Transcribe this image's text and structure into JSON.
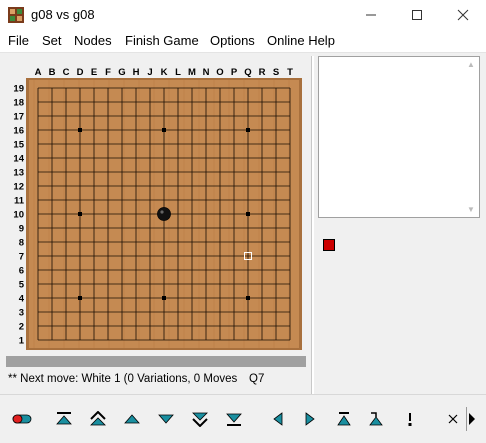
{
  "window": {
    "title": "g08 vs g08",
    "controls": [
      "minimize",
      "maximize",
      "close"
    ]
  },
  "menu": [
    "File",
    "Set",
    "Nodes",
    "Finish Game",
    "Options",
    "Online Help"
  ],
  "board": {
    "size": 19,
    "columns": [
      "A",
      "B",
      "C",
      "D",
      "E",
      "F",
      "G",
      "H",
      "J",
      "K",
      "L",
      "M",
      "N",
      "O",
      "P",
      "Q",
      "R",
      "S",
      "T"
    ],
    "rows": [
      "19",
      "18",
      "17",
      "16",
      "15",
      "14",
      "13",
      "12",
      "11",
      "10",
      "9",
      "8",
      "7",
      "6",
      "5",
      "4",
      "3",
      "2",
      "1"
    ],
    "colors": {
      "wood": "#c58a52",
      "frame": "#a8703d",
      "line": "#1a0e05",
      "black_stone": "#111111"
    },
    "star_points": [
      "D16",
      "K16",
      "Q16",
      "D10",
      "Q10",
      "D4",
      "K4",
      "Q4"
    ],
    "stones": [
      {
        "point": "K10",
        "color": "black"
      }
    ],
    "marker": {
      "point": "Q7",
      "type": "last-move-square"
    }
  },
  "status": {
    "text": "** Next move: White 1 (0 Variations, 0 Moves",
    "move": "Q7"
  },
  "status_square_color": "#cc0000",
  "toolbar": [
    "record-icon",
    "first-move-icon",
    "fast-back-icon",
    "back-icon",
    "forward-icon",
    "fast-forward-icon",
    "last-move-icon",
    "previous-variation-icon",
    "next-variation-icon",
    "main-line-icon",
    "variation-icon",
    "mark-icon",
    "close-icon",
    "scroll-right-icon"
  ]
}
